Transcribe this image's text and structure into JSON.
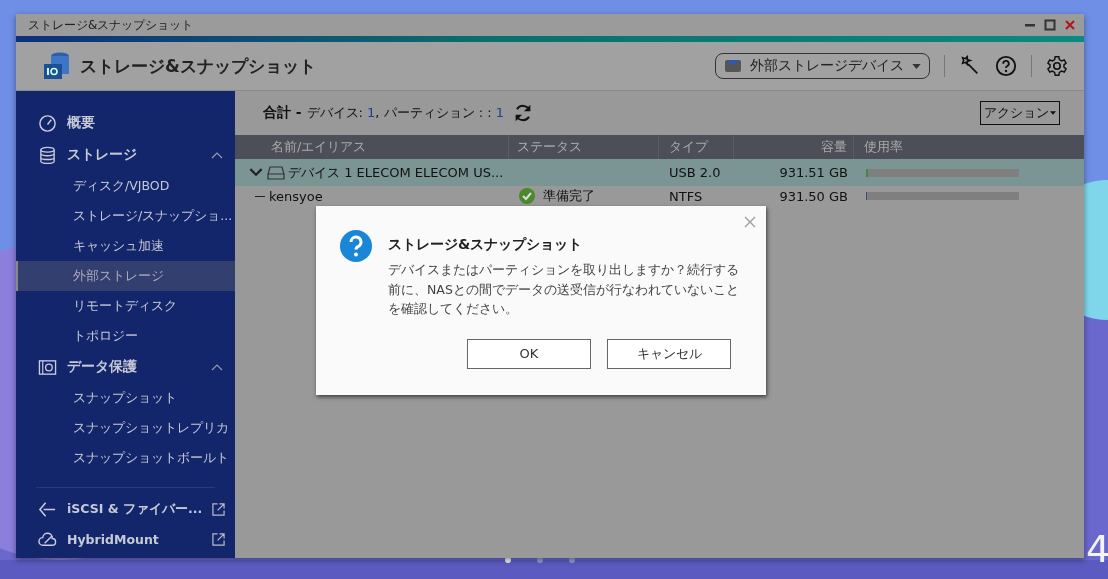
{
  "window": {
    "title": "ストレージ&スナップショット"
  },
  "header": {
    "app_title": "ストレージ&スナップショット",
    "device_dropdown": "外部ストレージデバイス"
  },
  "sidebar": {
    "items": [
      {
        "label": "概要",
        "kind": "overview"
      },
      {
        "label": "ストレージ",
        "kind": "storage",
        "expanded": true,
        "children": [
          {
            "label": "ディスク/VJBOD",
            "selected": false
          },
          {
            "label": "ストレージ/スナップショ...",
            "selected": false
          },
          {
            "label": "キャッシュ加速",
            "selected": false
          },
          {
            "label": "外部ストレージ",
            "selected": true
          },
          {
            "label": "リモートディスク",
            "selected": false
          },
          {
            "label": "トポロジー",
            "selected": false
          }
        ]
      },
      {
        "label": "データ保護",
        "kind": "protection",
        "expanded": true,
        "children": [
          {
            "label": "スナップショット",
            "selected": false
          },
          {
            "label": "スナップショットレプリカ",
            "selected": false
          },
          {
            "label": "スナップショットボールト",
            "selected": false
          }
        ]
      }
    ],
    "links": [
      {
        "label": "iSCSI & ファイバー...",
        "kind": "iscsi"
      },
      {
        "label": "HybridMount",
        "kind": "cloud"
      }
    ]
  },
  "summary": {
    "label": "合計 - ",
    "devices_label": "デバイス: ",
    "devices": "1",
    "partitions_label": ", パーティション : : ",
    "partitions": "1"
  },
  "action_button": "アクション",
  "table": {
    "columns": [
      "名前/エイリアス",
      "ステータス",
      "タイプ",
      "容量",
      "使用率"
    ],
    "rows": [
      {
        "kind": "device",
        "name": "デバイス 1 ELECOM ELECOM US...",
        "status": "",
        "type": "USB 2.0",
        "capacity": "931.51 GB",
        "level": 0.01,
        "selected": true
      },
      {
        "kind": "partition",
        "name": "kensyoe",
        "status": "準備完了",
        "type": "NTFS",
        "capacity": "931.50 GB",
        "level": 0.005,
        "selected": false
      }
    ]
  },
  "dialog": {
    "title": "ストレージ&スナップショット",
    "message": "デバイスまたはパーティションを取り出しますか？続行する前に、NASとの間でデータの送受信が行なわれていないことを確認してください。",
    "buttons": [
      "OK",
      "キャンセル"
    ]
  },
  "desktop": {
    "clock": "4"
  }
}
